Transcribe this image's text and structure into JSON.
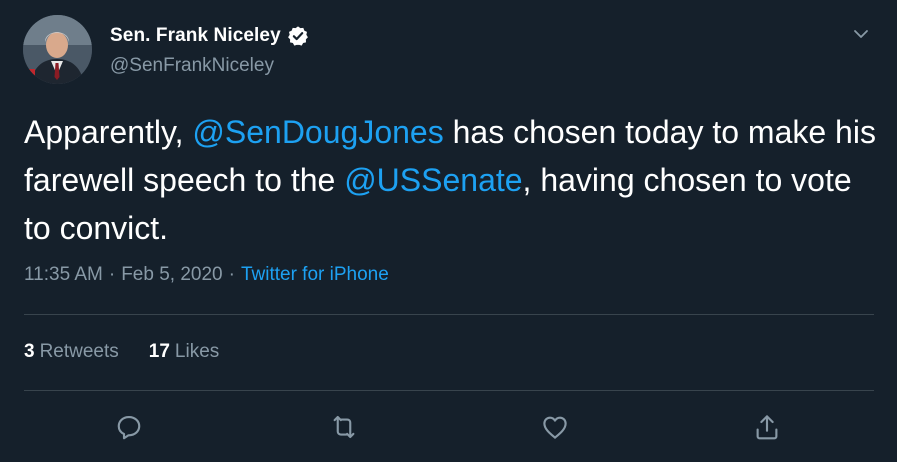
{
  "author": {
    "display_name": "Sen. Frank Niceley",
    "handle": "@SenFrankNiceley",
    "verified": true
  },
  "tweet": {
    "text_parts": [
      "Apparently, ",
      "@SenDougJones",
      " has chosen today to make his farewell speech to the ",
      "@USSenate",
      ", having chosen to vote to convict."
    ],
    "time": "11:35 AM",
    "date": "Feb 5, 2020",
    "separator": "·",
    "source": "Twitter for iPhone"
  },
  "stats": {
    "retweets_count": "3",
    "retweets_label": "Retweets",
    "likes_count": "17",
    "likes_label": "Likes"
  },
  "actions": [
    "reply-icon",
    "retweet-icon",
    "like-icon",
    "share-icon"
  ],
  "colors": {
    "background": "#15202b",
    "text": "#ffffff",
    "secondary": "#8899a6",
    "link": "#1da1f2",
    "divider": "#38444d"
  }
}
